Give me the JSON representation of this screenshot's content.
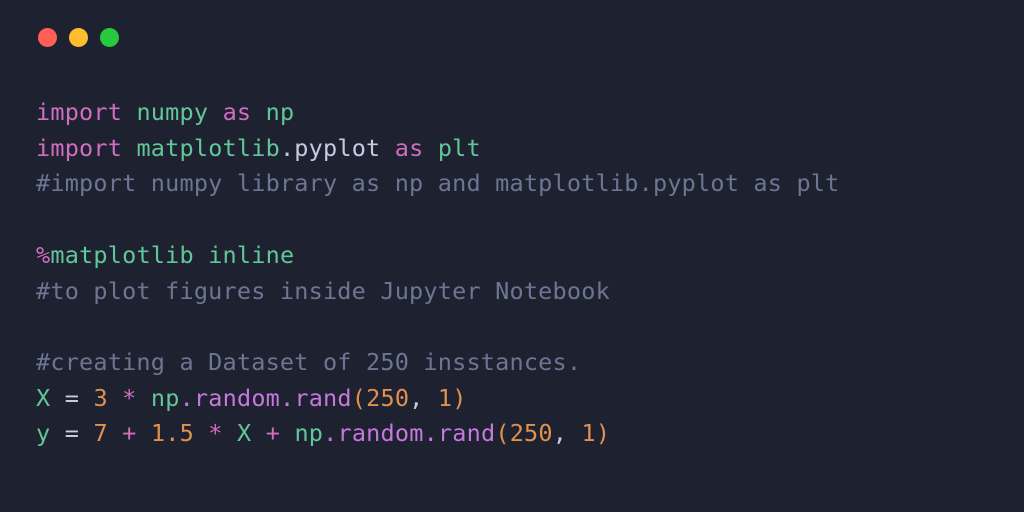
{
  "window": {
    "traffic_lights": [
      "red",
      "yellow",
      "green"
    ]
  },
  "code": {
    "l1": {
      "kw1": "import",
      "sp1": " ",
      "mod": "numpy",
      "sp2": " ",
      "kw2": "as",
      "sp3": " ",
      "alias": "np"
    },
    "l2": {
      "kw1": "import",
      "sp1": " ",
      "mod": "matplotlib",
      "dot": ".",
      "sub": "pyplot",
      "sp2": " ",
      "kw2": "as",
      "sp3": " ",
      "alias": "plt"
    },
    "l3": {
      "text": "#import numpy library as np and matplotlib.pyplot as plt"
    },
    "l4": {
      "blank": ""
    },
    "l5": {
      "magic": "%",
      "mod": "matplotlib",
      "sp": " ",
      "inline": "inline"
    },
    "l6": {
      "text": "#to plot figures inside Jupyter Notebook"
    },
    "l7": {
      "blank": ""
    },
    "l8": {
      "text": "#creating a Dataset of 250 insstances."
    },
    "l9": {
      "ident": "X",
      "sp1": " ",
      "eq": "=",
      "sp2": " ",
      "num": "3",
      "sp3": " ",
      "op": "*",
      "sp4": " ",
      "npid": "np",
      "attr": ".random.rand",
      "open": "(",
      "a1": "250",
      "comma": ",",
      "sp5": " ",
      "a2": "1",
      "close": ")"
    },
    "l10": {
      "ident": "y",
      "sp1": " ",
      "eq": "=",
      "sp2": " ",
      "num1": "7",
      "sp3": " ",
      "op1": "+",
      "sp4": " ",
      "num2": "1.5",
      "sp5": " ",
      "op2": "*",
      "sp6": " ",
      "xid": "X",
      "sp7": " ",
      "op3": "+",
      "sp8": " ",
      "npid": "np",
      "attr": ".random.rand",
      "open": "(",
      "a1": "250",
      "comma": ",",
      "sp9": " ",
      "a2": "1",
      "close": ")"
    }
  }
}
